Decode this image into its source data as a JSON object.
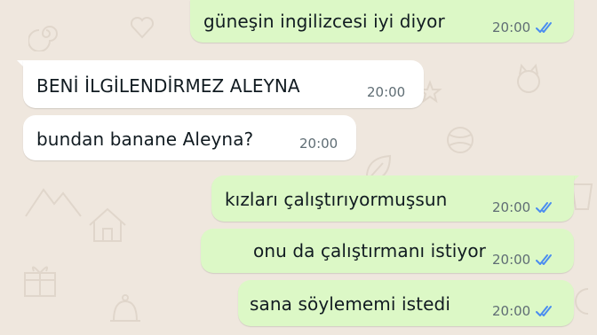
{
  "messages": [
    {
      "text": "güneşin ingilizcesi iyi diyor",
      "time": "20:00",
      "direction": "outgoing",
      "status": "read"
    },
    {
      "text": "BENİ İLGİLENDİRMEZ ALEYNA",
      "time": "20:00",
      "direction": "incoming"
    },
    {
      "text": "bundan banane Aleyna?",
      "time": "20:00",
      "direction": "incoming"
    },
    {
      "text": "kızları çalıştırıyormuşsun",
      "time": "20:00",
      "direction": "outgoing",
      "status": "read"
    },
    {
      "text": "onu da çalıştırmanı istiyor",
      "time": "20:00",
      "direction": "outgoing",
      "status": "read"
    },
    {
      "text": "sana söylememi istedi",
      "time": "20:00",
      "direction": "outgoing",
      "status": "read"
    }
  ],
  "colors": {
    "background": "#efe7de",
    "incoming_bubble": "#ffffff",
    "outgoing_bubble": "#dcf8c6",
    "read_receipt": "#4a8cf0"
  },
  "icons": {
    "read_receipt": "double-check-icon",
    "wallpaper": "chat-wallpaper-doodles"
  }
}
